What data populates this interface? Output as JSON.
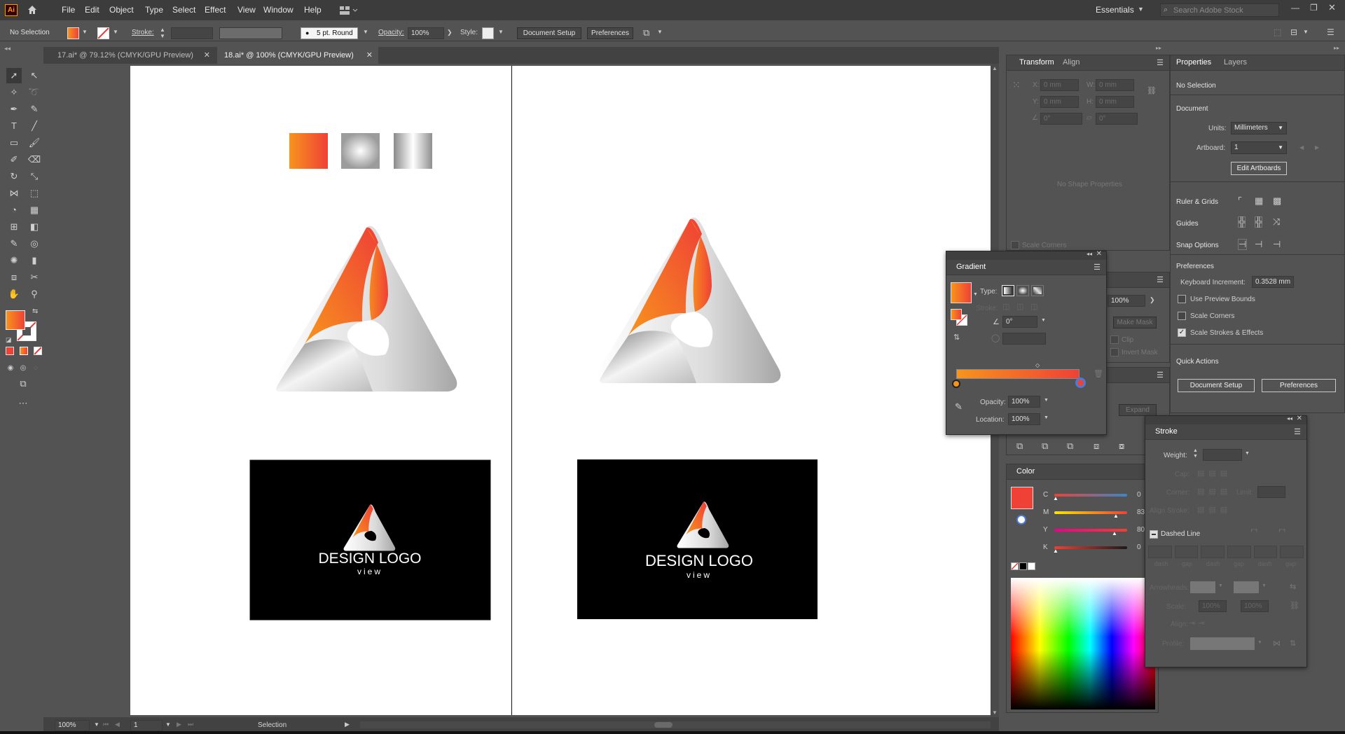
{
  "app": {
    "logo": "Ai",
    "workspace": "Essentials",
    "search_placeholder": "Search Adobe Stock"
  },
  "menu": [
    "File",
    "Edit",
    "Object",
    "Type",
    "Select",
    "Effect",
    "View",
    "Window",
    "Help"
  ],
  "control_bar": {
    "selection": "No Selection",
    "stroke_label": "Stroke:",
    "brush": "5 pt. Round",
    "opacity_label": "Opacity:",
    "opacity_value": "100%",
    "style_label": "Style:",
    "document_setup": "Document Setup",
    "preferences": "Preferences"
  },
  "tabs": [
    {
      "label": "17.ai* @ 79.12% (CMYK/GPU Preview)"
    },
    {
      "label": "18.ai* @ 100% (CMYK/GPU Preview)"
    }
  ],
  "artwork": {
    "logo_text": "DESIGN LOGO",
    "logo_sub": "view"
  },
  "transform_panel": {
    "tabs": [
      "Transform",
      "Align"
    ],
    "x_label": "X:",
    "y_label": "Y:",
    "w_label": "W:",
    "h_label": "H:",
    "x_value": "0 mm",
    "y_value": "0 mm",
    "w_value": "0 mm",
    "h_value": "0 mm",
    "angle": "0°",
    "shear": "0°",
    "no_shape": "No Shape Properties",
    "scale_corners": "Scale Corners"
  },
  "gradient_panel": {
    "title": "Gradient",
    "type_label": "Type:",
    "stroke_label": "Stroke:",
    "angle": "0°",
    "opacity_label": "Opacity:",
    "opacity_value": "100%",
    "location_label": "Location:",
    "location_value": "100%",
    "colors": {
      "start": "#f7941d",
      "end": "#ef4136"
    }
  },
  "transparency_panel": {
    "opacity": "100%",
    "make_mask": "Make Mask",
    "clip": "Clip",
    "invert_mask": "Invert Mask",
    "expand": "Expand"
  },
  "color_panel": {
    "title": "Color",
    "channels": [
      {
        "label": "C",
        "value": "0",
        "level": 0
      },
      {
        "label": "M",
        "value": "83.",
        "level": 0.83
      },
      {
        "label": "Y",
        "value": "80.",
        "level": 0.8
      },
      {
        "label": "K",
        "value": "0",
        "level": 0
      }
    ],
    "fill": "#ef4136"
  },
  "stroke_panel": {
    "title": "Stroke",
    "weight_label": "Weight:",
    "cap_label": "Cap:",
    "corner_label": "Corner:",
    "limit_label": "Limit:",
    "align_label": "Align Stroke:",
    "dashed_line": "Dashed Line",
    "dash_labels": [
      "dash",
      "gap",
      "dash",
      "gap",
      "dash",
      "gap"
    ],
    "arrowheads_label": "Arrowheads:",
    "scale_label": "Scale:",
    "scale1": "100%",
    "scale2": "100%",
    "align2_label": "Align:",
    "profile_label": "Profile:"
  },
  "properties_panel": {
    "tabs": [
      "Properties",
      "Layers"
    ],
    "selection": "No Selection",
    "document": "Document",
    "units_label": "Units:",
    "units_value": "Millimeters",
    "artboard_label": "Artboard:",
    "artboard_value": "1",
    "edit_artboards": "Edit Artboards",
    "ruler_grids": "Ruler & Grids",
    "guides": "Guides",
    "snap_options": "Snap Options",
    "preferences": "Preferences",
    "keyboard_increment_label": "Keyboard Increment:",
    "keyboard_increment_value": "0.3528 mm",
    "use_preview_bounds": "Use Preview Bounds",
    "scale_corners": "Scale Corners",
    "scale_strokes": "Scale Strokes & Effects",
    "quick_actions": "Quick Actions",
    "document_setup": "Document Setup",
    "preferences_btn": "Preferences"
  },
  "status": {
    "zoom": "100%",
    "artboard": "1",
    "tool": "Selection"
  }
}
